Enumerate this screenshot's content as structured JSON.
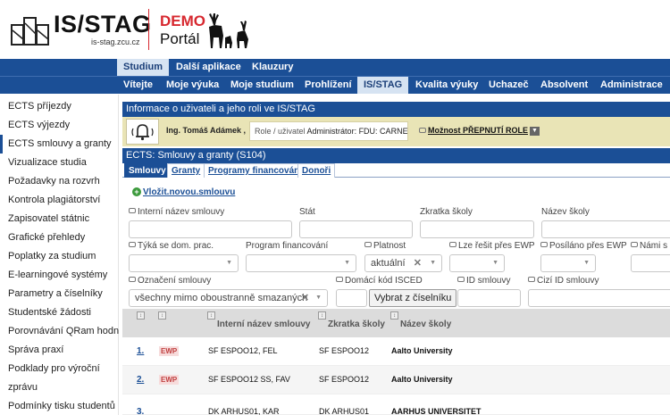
{
  "header": {
    "logo_title": "IS/STAG",
    "logo_sub": "is-stag.zcu.cz",
    "demo": "DEMO",
    "portal": "Portál"
  },
  "topnav1": [
    "Studium",
    "Další aplikace",
    "Klauzury"
  ],
  "topnav2": [
    "Vítejte",
    "Moje výuka",
    "Moje studium",
    "Prohlížení",
    "IS/STAG",
    "Kvalita výuky",
    "Uchazeč",
    "Absolvent",
    "Administrace"
  ],
  "sidebar": [
    "ECTS příjezdy",
    "ECTS výjezdy",
    "ECTS smlouvy a granty",
    "Vizualizace studia",
    "Požadavky na rozvrh",
    "Kontrola plagiátorství",
    "Zapisovatel státnic",
    "Grafické přehledy",
    "Poplatky za studium",
    "E-learningové systémy",
    "Parametry a číselníky",
    "Studentské žádosti",
    "Porovnávání QRam hodnot",
    "Správa praxí",
    "Podklady pro výroční",
    "zprávu",
    "Podmínky tisku studentů"
  ],
  "info": {
    "title": "Informace o uživateli a jeho roli ve IS/STAG",
    "user": "Ing. Tomáš Adámek ,",
    "role_label": "Role / uživatel",
    "role_value": "Administrátor: FDU: CARNEY",
    "switch_role": "Možnost PŘEPNUTÍ ROLE"
  },
  "section": {
    "title": "ECTS: Smlouvy a granty (S104)"
  },
  "tabs": [
    "Smlouvy",
    "Granty",
    "Programy financování",
    "Donoři"
  ],
  "add_link": "Vložit.novou.smlouvu",
  "filters": {
    "internal_name": "Interní název smlouvy",
    "state": "Stát",
    "school_abbr": "Zkratka školy",
    "school_name": "Název školy",
    "dom_prac": "Týká se dom. prac.",
    "program": "Program financování",
    "validity": "Platnost",
    "validity_value": "aktuální",
    "ewp_solve": "Lze řešit přes EWP",
    "ewp_sent": "Posíláno přes EWP",
    "nami": "Námi s",
    "marking": "Označení smlouvy",
    "marking_value": "všechny mimo oboustranně smazaných",
    "isced": "Domácí kód ISCED",
    "isced_button": "Vybrat z číselníku",
    "contract_id": "ID smlouvy",
    "foreign_id": "Cizí ID smlouvy"
  },
  "table": {
    "headers": [
      "Interní název smlouvy",
      "Zkratka školy",
      "Název školy"
    ],
    "rows": [
      {
        "num": "1.",
        "ewp": "EWP",
        "internal": "SF ESPOO12, FEL",
        "abbr": "SF ESPOO12",
        "school": "Aalto University"
      },
      {
        "num": "2.",
        "ewp": "EWP",
        "internal": "SF ESPOO12 SS, FAV",
        "abbr": "SF ESPOO12",
        "school": "Aalto University"
      },
      {
        "num": "3.",
        "ewp": "",
        "internal": "DK ARHUS01, KAR",
        "abbr": "DK ARHUS01",
        "school": "AARHUS UNIVERSITET"
      }
    ]
  }
}
